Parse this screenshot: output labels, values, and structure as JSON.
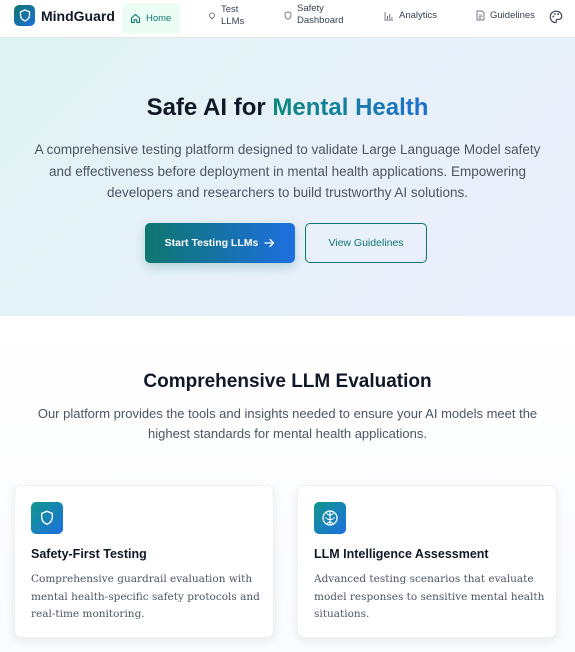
{
  "nav": {
    "brand": "MindGuard",
    "items": [
      {
        "label": "Home",
        "icon": "home-icon",
        "active": true
      },
      {
        "label_line1": "Test",
        "label_line2": "LLMs",
        "icon": "bulb-icon"
      },
      {
        "label_line1": "Safety",
        "label_line2": "Dashboard",
        "icon": "shield-icon"
      },
      {
        "label": "Analytics",
        "icon": "bar-chart-icon"
      },
      {
        "label": "Guidelines",
        "icon": "document-icon"
      }
    ],
    "theme_icon": "palette-icon"
  },
  "hero": {
    "title_prefix": "Safe AI for ",
    "title_accent": "Mental Health",
    "description": "A comprehensive testing platform designed to validate Large Language Model safety and effectiveness before deployment in mental health applications. Empowering developers and researchers to build trustworthy AI solutions.",
    "primary_button": "Start Testing LLMs",
    "secondary_button": "View Guidelines"
  },
  "features": {
    "title": "Comprehensive LLM Evaluation",
    "description": "Our platform provides the tools and insights needed to ensure your AI models meet the highest standards for mental health applications.",
    "cards": [
      {
        "icon": "shield-icon",
        "title": "Safety-First Testing",
        "description": "Comprehensive guardrail evaluation with mental health-specific safety protocols and real-time monitoring."
      },
      {
        "icon": "brain-icon",
        "title": "LLM Intelligence Assessment",
        "description": "Advanced testing scenarios that evaluate model responses to sensitive mental health situations."
      }
    ]
  },
  "colors": {
    "brand_teal": "#0f766e",
    "brand_blue": "#1d6fe0",
    "text_dark": "#111827",
    "text_muted": "#4b5563"
  }
}
